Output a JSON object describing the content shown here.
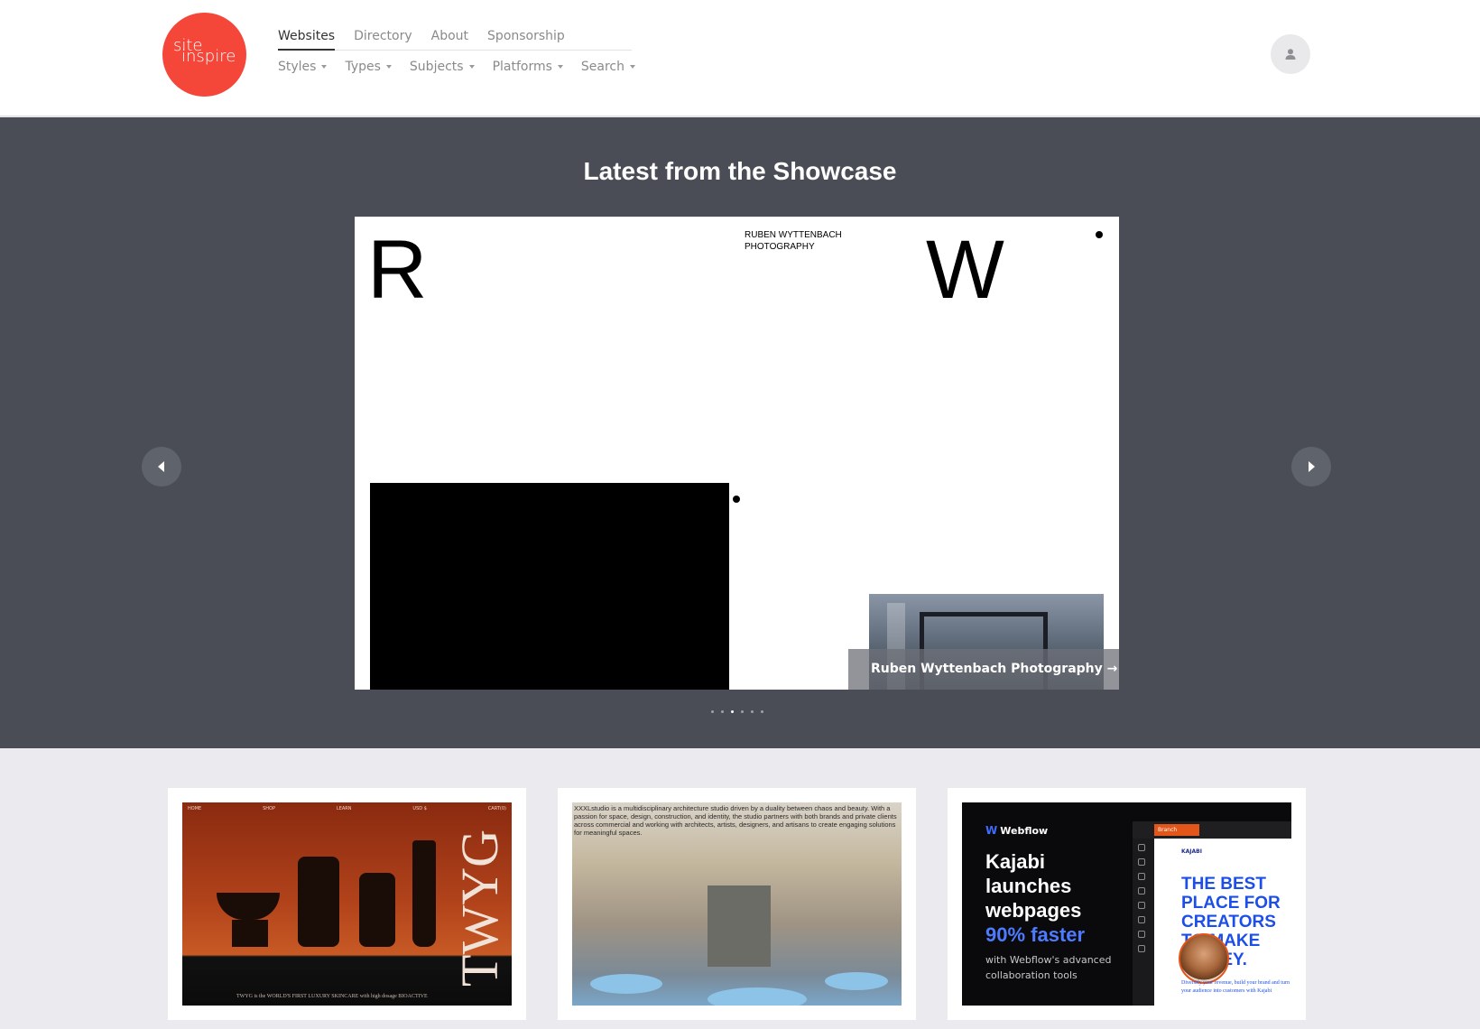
{
  "header": {
    "logo": {
      "line1": "site",
      "line2": "inspire"
    },
    "primary_nav": [
      {
        "label": "Websites",
        "active": true
      },
      {
        "label": "Directory",
        "active": false
      },
      {
        "label": "About",
        "active": false
      },
      {
        "label": "Sponsorship",
        "active": false
      }
    ],
    "secondary_nav": [
      {
        "label": "Styles"
      },
      {
        "label": "Types"
      },
      {
        "label": "Subjects"
      },
      {
        "label": "Platforms"
      },
      {
        "label": "Search"
      }
    ],
    "user_icon": "user-icon"
  },
  "showcase": {
    "title": "Latest from the Showcase",
    "slide": {
      "letter_left": "R",
      "letter_right": "W",
      "brand_text": "RUBEN WYTTENBACH PHOTOGRAPHY",
      "caption": "Ruben Wyttenbach Photography →"
    },
    "prev_icon": "triangle-left-icon",
    "next_icon": "triangle-right-icon",
    "dots_count": 6,
    "active_dot": 2
  },
  "cards": [
    {
      "id": "twyg",
      "nav": [
        "HOME",
        "SHOP",
        "LEARN",
        "USD $",
        "CART(0)"
      ],
      "brand": "TWYG",
      "footer": "TWYG is the WORLD'S FIRST LUXURY SKINCARE with high dosage BIOACTIVE"
    },
    {
      "id": "xxxl",
      "text": "XXXLstudio is a multidisciplinary architecture studio driven by a duality between chaos and beauty. With a passion for space, design, construction, and identity, the studio partners with both brands and private clients across commercial and working with architects, artists, designers, and artisans to create engaging solutions for meaningful spaces."
    },
    {
      "id": "webflow",
      "brand": "Webflow",
      "headline_1": "Kajabi launches webpages",
      "headline_2": "90% faster",
      "subtext": "with Webflow's advanced collaboration tools",
      "branch_label": "Branch",
      "kajabi_brand": "KAJABI",
      "kajabi_headline": "THE BEST PLACE FOR CREATORS TO MAKE MONEY.",
      "kajabi_sub": "Diversify your revenue, build your brand and turn your audience into customers with Kajabi"
    }
  ]
}
